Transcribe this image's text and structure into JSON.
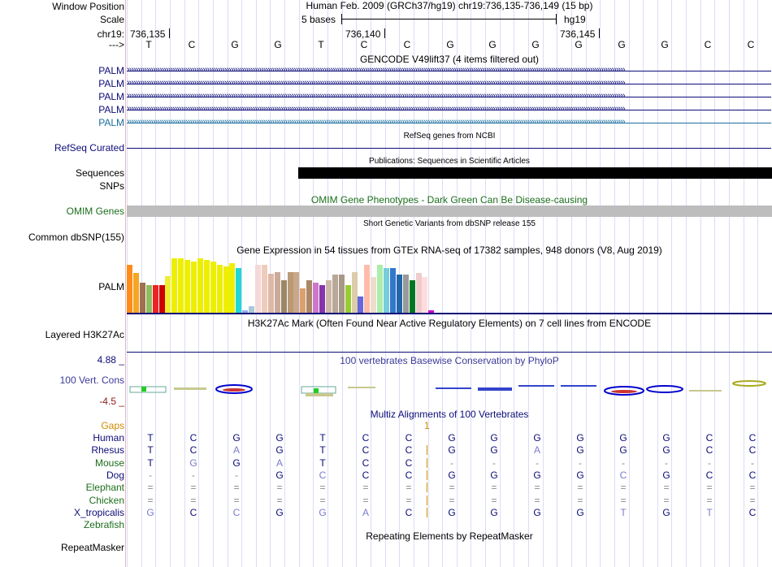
{
  "header": {
    "window_position_label": "Window Position",
    "window_position_value": "Human Feb. 2009 (GRCh37/hg19)   chr19:736,135-736,149 (15 bp)",
    "scale_label": "Scale",
    "scale_value": "5 bases",
    "assembly": "hg19",
    "chrom_label": "chr19:",
    "ticks": [
      "736,135",
      "736,140",
      "736,145"
    ],
    "strand_label": "--->",
    "bases": [
      "T",
      "C",
      "G",
      "G",
      "T",
      "C",
      "C",
      "G",
      "G",
      "G",
      "G",
      "G",
      "G",
      "C",
      "C"
    ]
  },
  "gencode": {
    "title": "GENCODE V49lift37 (4 items filtered out)",
    "items": [
      "PALM",
      "PALM",
      "PALM",
      "PALM",
      "PALM"
    ],
    "colors": [
      "#0c0c78",
      "#0c0c78",
      "#0c0c78",
      "#0c0c78",
      "#1a6e9e"
    ]
  },
  "refseq": {
    "title": "RefSeq genes from NCBI",
    "label": "RefSeq Curated"
  },
  "pubs": {
    "title": "Publications: Sequences in Scientific Articles",
    "labels": [
      "Sequences",
      "SNPs"
    ]
  },
  "omim": {
    "title": "OMIM Gene Phenotypes - Dark Green Can Be Disease-causing",
    "label": "OMIM Genes"
  },
  "dbsnp": {
    "title": "Short Genetic Variants from dbSNP release 155",
    "label": "Common dbSNP(155)"
  },
  "gtex": {
    "title": "Gene Expression in 54 tissues from GTEx RNA-seq of 17382 samples, 948 donors (V8, Aug 2019)",
    "label": "PALM",
    "bars": [
      {
        "v": 0.88,
        "c": "#ff8c1a"
      },
      {
        "v": 0.73,
        "c": "#f5a623"
      },
      {
        "v": 0.55,
        "c": "#a07050"
      },
      {
        "v": 0.5,
        "c": "#8fbc5f"
      },
      {
        "v": 0.5,
        "c": "#ee2222"
      },
      {
        "v": 0.5,
        "c": "#cc0000"
      },
      {
        "v": 0.67,
        "c": "#eeee33"
      },
      {
        "v": 1.0,
        "c": "#eeee00"
      },
      {
        "v": 1.0,
        "c": "#eeee00"
      },
      {
        "v": 0.97,
        "c": "#eeee00"
      },
      {
        "v": 0.94,
        "c": "#eeee00"
      },
      {
        "v": 1.0,
        "c": "#eeee00"
      },
      {
        "v": 0.97,
        "c": "#eeee00"
      },
      {
        "v": 0.94,
        "c": "#eeee00"
      },
      {
        "v": 0.88,
        "c": "#eeee00"
      },
      {
        "v": 0.85,
        "c": "#eeee00"
      },
      {
        "v": 0.91,
        "c": "#eeee00"
      },
      {
        "v": 0.82,
        "c": "#1fd7d7"
      },
      {
        "v": 0.05,
        "c": "#99aaee"
      },
      {
        "v": 0.12,
        "c": "#a8c8d8"
      },
      {
        "v": 0.88,
        "c": "#f5d8d8"
      },
      {
        "v": 0.88,
        "c": "#eeccbb"
      },
      {
        "v": 0.72,
        "c": "#ddb8a8"
      },
      {
        "v": 0.75,
        "c": "#ccaa99"
      },
      {
        "v": 0.6,
        "c": "#998866"
      },
      {
        "v": 0.75,
        "c": "#bb9977"
      },
      {
        "v": 0.75,
        "c": "#c8a888"
      },
      {
        "v": 0.45,
        "c": "#dca070"
      },
      {
        "v": 0.6,
        "c": "#aa8866"
      },
      {
        "v": 0.55,
        "c": "#cc77cc"
      },
      {
        "v": 0.5,
        "c": "#8833aa"
      },
      {
        "v": 0.6,
        "c": "#ccb8a8"
      },
      {
        "v": 0.7,
        "c": "#b8a898"
      },
      {
        "v": 0.7,
        "c": "#a89888"
      },
      {
        "v": 0.5,
        "c": "#99cc33"
      },
      {
        "v": 0.75,
        "c": "#ddccaa"
      },
      {
        "v": 0.3,
        "c": "#6666dd"
      },
      {
        "v": 0.88,
        "c": "#ffbbaa"
      },
      {
        "v": 0.65,
        "c": "#eeddcc"
      },
      {
        "v": 0.88,
        "c": "#aaeeaa"
      },
      {
        "v": 0.82,
        "c": "#77ccdd"
      },
      {
        "v": 0.82,
        "c": "#3377cc"
      },
      {
        "v": 0.7,
        "c": "#2266aa"
      },
      {
        "v": 0.7,
        "c": "#999999"
      },
      {
        "v": 0.6,
        "c": "#007722"
      },
      {
        "v": 0.73,
        "c": "#eecccc"
      },
      {
        "v": 0.65,
        "c": "#ffdddd"
      },
      {
        "v": 0.05,
        "c": "#cc00cc"
      }
    ]
  },
  "h3k27ac": {
    "title": "H3K27Ac Mark (Often Found Near Active Regulatory Elements) on 7 cell lines from ENCODE",
    "label": "Layered H3K27Ac"
  },
  "phylop": {
    "title": "100 vertebrates Basewise Conservation by PhyloP",
    "label": "100 Vert. Cons",
    "ymax": "4.88 _",
    "ymin": "-4.5 _"
  },
  "multiz": {
    "title": "Multiz Alignments of 100 Vertebrates",
    "gaps_label": "Gaps",
    "gap_count": "1",
    "species": [
      {
        "name": "Human",
        "color": "#0c0c78",
        "seq": [
          "T",
          "C",
          "G",
          "G",
          "T",
          "C",
          "C",
          "G",
          "G",
          "G",
          "G",
          "G",
          "G",
          "C",
          "C"
        ]
      },
      {
        "name": "Rhesus",
        "color": "#0c0c78",
        "seq": [
          "T",
          "C",
          "A",
          "G",
          "T",
          "C",
          "C",
          "G",
          "G",
          "A",
          "G",
          "G",
          "G",
          "C",
          "C"
        ]
      },
      {
        "name": "Mouse",
        "color": "#1b6e1b",
        "seq": [
          "T",
          "G",
          "G",
          "A",
          "T",
          "C",
          "C",
          "-",
          "-",
          "-",
          "-",
          "-",
          "-",
          "-",
          "-"
        ]
      },
      {
        "name": "Dog",
        "color": "#0c0c78",
        "seq": [
          "-",
          "-",
          "-",
          "G",
          "C",
          "C",
          "C",
          "G",
          "G",
          "G",
          "G",
          "C",
          "G",
          "C",
          "C"
        ]
      },
      {
        "name": "Elephant",
        "color": "#1b6e1b",
        "seq": [
          "=",
          "=",
          "=",
          "=",
          "=",
          "=",
          "=",
          "=",
          "=",
          "=",
          "=",
          "=",
          "=",
          "=",
          "="
        ]
      },
      {
        "name": "Chicken",
        "color": "#1b6e1b",
        "seq": [
          "=",
          "=",
          "=",
          "=",
          "=",
          "=",
          "=",
          "=",
          "=",
          "=",
          "=",
          "=",
          "=",
          "=",
          "="
        ]
      },
      {
        "name": "X_tropicalis",
        "color": "#0c0c78",
        "seq": [
          "G",
          "C",
          "C",
          "G",
          "G",
          "A",
          "C",
          "G",
          "G",
          "G",
          "G",
          "T",
          "G",
          "T",
          "C"
        ]
      },
      {
        "name": "Zebrafish",
        "color": "#1b6e1b",
        "seq": []
      }
    ]
  },
  "repeatmasker": {
    "title": "Repeating Elements by RepeatMasker",
    "label": "RepeatMasker"
  }
}
